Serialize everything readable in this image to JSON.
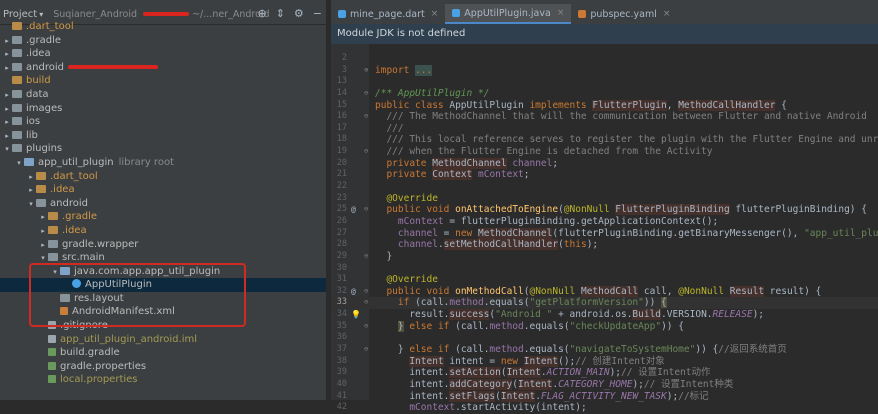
{
  "project_panel": {
    "title": "Project",
    "root_label": "Suqianer_Android",
    "root_path_tail": "~/...ner_Android",
    "tree": [
      {
        "label": ".dart_tool",
        "indent": 0,
        "arrow": "",
        "icon": "folder-orange",
        "color": "orange"
      },
      {
        "label": ".gradle",
        "indent": 0,
        "arrow": "▸",
        "icon": "folder",
        "color": "lt"
      },
      {
        "label": ".idea",
        "indent": 0,
        "arrow": "▸",
        "icon": "folder",
        "color": "lt"
      },
      {
        "label": "android",
        "indent": 0,
        "arrow": "▸",
        "icon": "folder",
        "color": "lt",
        "suffix": "[s...]",
        "redact": true
      },
      {
        "label": "build",
        "indent": 0,
        "arrow": "",
        "icon": "folder-orange",
        "color": "orange"
      },
      {
        "label": "data",
        "indent": 0,
        "arrow": "▸",
        "icon": "folder",
        "color": "lt"
      },
      {
        "label": "images",
        "indent": 0,
        "arrow": "▸",
        "icon": "folder",
        "color": "lt"
      },
      {
        "label": "ios",
        "indent": 0,
        "arrow": "▸",
        "icon": "folder",
        "color": "lt"
      },
      {
        "label": "lib",
        "indent": 0,
        "arrow": "▸",
        "icon": "folder",
        "color": "lt"
      },
      {
        "label": "plugins",
        "indent": 0,
        "arrow": "▾",
        "icon": "folder",
        "color": "lt"
      },
      {
        "label": "app_util_plugin",
        "indent": 1,
        "arrow": "▾",
        "icon": "folder-module",
        "color": "lt",
        "suffix": "library root"
      },
      {
        "label": ".dart_tool",
        "indent": 2,
        "arrow": "▸",
        "icon": "folder-orange",
        "color": "orange"
      },
      {
        "label": ".idea",
        "indent": 2,
        "arrow": "▸",
        "icon": "folder-orange",
        "color": "orange"
      },
      {
        "label": "android",
        "indent": 2,
        "arrow": "▾",
        "icon": "folder",
        "color": "lt"
      },
      {
        "label": ".gradle",
        "indent": 3,
        "arrow": "▸",
        "icon": "folder-orange",
        "color": "orange"
      },
      {
        "label": ".idea",
        "indent": 3,
        "arrow": "▸",
        "icon": "folder-orange",
        "color": "orange"
      },
      {
        "label": "gradle.wrapper",
        "indent": 3,
        "arrow": "▸",
        "icon": "folder",
        "color": "lt"
      },
      {
        "label": "src.main",
        "indent": 3,
        "arrow": "▾",
        "icon": "folder",
        "color": "lt"
      },
      {
        "label": "java.com.app.app_util_plugin",
        "indent": 4,
        "arrow": "▾",
        "icon": "folder-module",
        "color": "lt"
      },
      {
        "label": "AppUtilPlugin",
        "indent": 5,
        "arrow": "",
        "icon": "class",
        "color": "lt",
        "selected": true
      },
      {
        "label": "res.layout",
        "indent": 4,
        "arrow": "",
        "icon": "folder",
        "color": "lt"
      },
      {
        "label": "AndroidManifest.xml",
        "indent": 4,
        "arrow": "",
        "icon": "xml",
        "color": "lt"
      },
      {
        "label": ".gitignore",
        "indent": 3,
        "arrow": "",
        "icon": "file",
        "color": "lt"
      },
      {
        "label": "app_util_plugin_android.iml",
        "indent": 3,
        "arrow": "",
        "icon": "file",
        "color": "olive"
      },
      {
        "label": "build.gradle",
        "indent": 3,
        "arrow": "",
        "icon": "gradle",
        "color": "lt"
      },
      {
        "label": "gradle.properties",
        "indent": 3,
        "arrow": "",
        "icon": "gradle",
        "color": "lt"
      },
      {
        "label": "local.properties",
        "indent": 3,
        "arrow": "",
        "icon": "gradle",
        "color": "olive"
      }
    ]
  },
  "tabs": [
    {
      "label": "mine_page.dart",
      "active": false,
      "icon_color": "#4aa2e6"
    },
    {
      "label": "AppUtilPlugin.java",
      "active": true,
      "icon_color": "#4aa2e6"
    },
    {
      "label": "pubspec.yaml",
      "active": false,
      "icon_color": "#cc7832"
    }
  ],
  "banner": "Module JDK is not defined",
  "colors": {
    "accent": "#4a88c7",
    "highlight_box": "#d12a23"
  }
}
